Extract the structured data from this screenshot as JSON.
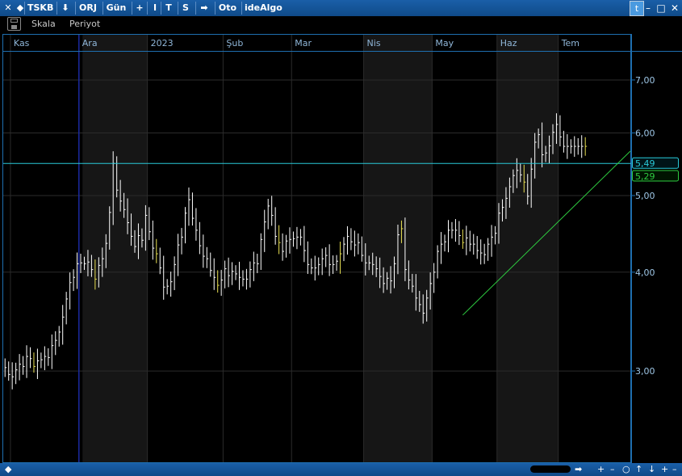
{
  "titlebar": {
    "items": [
      {
        "name": "close-icon",
        "label": "✕"
      },
      {
        "name": "back-arrow-icon",
        "label": "◆"
      },
      {
        "name": "symbol-button",
        "label": "TSKB"
      },
      {
        "name": "download-icon",
        "label": "⬇"
      },
      {
        "name": "orj-button",
        "label": "ORJ"
      },
      {
        "name": "period-button",
        "label": "Gün"
      },
      {
        "name": "plus-button",
        "label": "+"
      },
      {
        "name": "i-button",
        "label": "I"
      },
      {
        "name": "t-button",
        "label": "T"
      },
      {
        "name": "s-button",
        "label": "S"
      },
      {
        "name": "forward-arrow-icon",
        "label": "➡"
      },
      {
        "name": "auto-button",
        "label": "Oto"
      },
      {
        "name": "idealgo-button",
        "label": "ideAlgo"
      }
    ],
    "window": {
      "minimize": "–",
      "maximize": "□",
      "close": "✕"
    }
  },
  "toolbar2": {
    "scale_label": "Skala",
    "period_label": "Periyot"
  },
  "statusbar": {
    "left_arrow": "◆",
    "right_arrow": "➡",
    "buttons": [
      "+",
      "–",
      "○",
      "↑",
      "↓",
      "+",
      "–"
    ]
  },
  "colors": {
    "background": "#000000",
    "bar": "#ffffff",
    "bar_alt": "#e8e052",
    "grid": "#2b2b2b",
    "shade": "#161616",
    "frame": "#1e6fb0",
    "axis_text": "#9ec6e6",
    "month_text": "#8fb6d8",
    "cyan_line": "#29c9d8",
    "green_line": "#2ecc40",
    "vertical_line": "#1a2aa0"
  },
  "chart_data": {
    "type": "line",
    "title": "TSKB",
    "subtitle": "",
    "xlabel": "",
    "ylabel": "",
    "y_scale": "log",
    "ylim": [
      2.3,
      7.6
    ],
    "y_ticks": [
      3.0,
      4.0,
      5.0,
      6.0,
      7.0
    ],
    "y_tick_labels": [
      "3,00",
      "4,00",
      "5,00",
      "6,00",
      "7,00"
    ],
    "x_ticks": [
      {
        "label": "Kas",
        "bar": 2
      },
      {
        "label": "Ara",
        "bar": 21
      },
      {
        "label": "2023",
        "bar": 40
      },
      {
        "label": "Şub",
        "bar": 61
      },
      {
        "label": "Mar",
        "bar": 80
      },
      {
        "label": "Nis",
        "bar": 100
      },
      {
        "label": "May",
        "bar": 119
      },
      {
        "label": "Haz",
        "bar": 137
      },
      {
        "label": "Tem",
        "bar": 154
      }
    ],
    "shaded_ranges": [
      [
        22,
        40
      ],
      [
        100,
        119
      ],
      [
        137,
        154
      ]
    ],
    "vertical_marker_bar": 21,
    "bar_count": 174,
    "series": [
      {
        "name": "",
        "close": [
          3.03,
          2.97,
          2.95,
          3.01,
          3.06,
          3.04,
          3.13,
          3.11,
          3.04,
          3.09,
          3.1,
          3.13,
          3.12,
          3.23,
          3.28,
          3.36,
          3.51,
          3.7,
          3.88,
          3.94,
          4.1,
          4.11,
          4.1,
          4.12,
          4.03,
          3.92,
          4.08,
          4.16,
          4.35,
          4.76,
          5.49,
          5.08,
          4.92,
          4.8,
          4.62,
          4.44,
          4.31,
          4.45,
          4.39,
          4.72,
          4.5,
          4.29,
          4.22,
          4.05,
          3.83,
          3.84,
          3.89,
          4.09,
          4.33,
          4.43,
          4.75,
          4.94,
          4.68,
          4.52,
          4.32,
          4.19,
          4.16,
          4.02,
          3.94,
          3.85,
          3.91,
          4.04,
          3.96,
          4.01,
          3.98,
          3.94,
          3.92,
          3.92,
          4.03,
          4.11,
          4.1,
          4.4,
          4.63,
          4.85,
          4.72,
          4.44,
          4.36,
          4.25,
          4.38,
          4.4,
          4.41,
          4.43,
          4.43,
          4.26,
          4.09,
          4.05,
          4.05,
          4.09,
          4.16,
          4.2,
          4.09,
          4.09,
          4.13,
          4.22,
          4.34,
          4.44,
          4.37,
          4.33,
          4.36,
          4.2,
          4.11,
          4.11,
          4.09,
          4.04,
          3.95,
          3.87,
          3.93,
          3.9,
          4.1,
          4.46,
          4.54,
          4.03,
          3.91,
          3.84,
          3.71,
          3.64,
          3.55,
          3.71,
          3.87,
          4.0,
          4.25,
          4.34,
          4.37,
          4.52,
          4.52,
          4.52,
          4.45,
          4.36,
          4.42,
          4.34,
          4.34,
          4.26,
          4.23,
          4.21,
          4.34,
          4.43,
          4.48,
          4.75,
          4.83,
          4.96,
          5.13,
          5.3,
          5.38,
          5.31,
          5.2,
          4.99,
          5.4,
          5.84,
          5.97,
          5.63,
          5.66,
          5.78,
          6.01,
          6.15,
          5.93,
          5.77,
          5.77,
          5.77,
          5.77,
          5.77,
          5.77,
          5.77
        ]
      }
    ],
    "annotations": [
      {
        "type": "horizontal_line",
        "value": 5.49,
        "label": "5,49",
        "color": "cyan"
      },
      {
        "type": "trend_line",
        "from": {
          "bar": 127,
          "value": 3.53
        },
        "to": {
          "bar": 174,
          "value": 5.69
        },
        "label": "5,29",
        "label_value": 5.29,
        "color": "green"
      }
    ]
  }
}
